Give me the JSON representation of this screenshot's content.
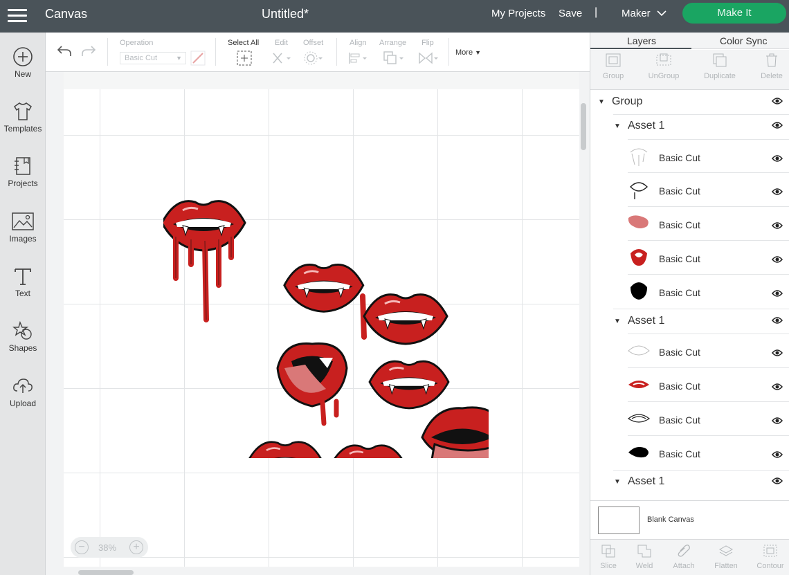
{
  "header": {
    "app_title": "Canvas",
    "doc_title": "Untitled*",
    "my_projects": "My Projects",
    "save": "Save",
    "separator": "|",
    "machine": "Maker",
    "make_it": "Make It",
    "make_color": "#1aa562"
  },
  "sidebar": {
    "items": [
      {
        "label": "New",
        "icon": "plus-circle-icon"
      },
      {
        "label": "Templates",
        "icon": "tshirt-icon"
      },
      {
        "label": "Projects",
        "icon": "projects-icon"
      },
      {
        "label": "Images",
        "icon": "image-icon"
      },
      {
        "label": "Text",
        "icon": "text-icon"
      },
      {
        "label": "Shapes",
        "icon": "shapes-icon"
      },
      {
        "label": "Upload",
        "icon": "upload-icon"
      }
    ]
  },
  "toolbar": {
    "operation_label": "Operation",
    "operation_value": "Basic Cut",
    "select_all": "Select All",
    "edit": "Edit",
    "offset": "Offset",
    "align": "Align",
    "arrange": "Arrange",
    "flip": "Flip",
    "more": "More"
  },
  "canvas": {
    "zoom": "38%",
    "zoom_minus": "−",
    "zoom_plus": "+",
    "artwork": "vampire lips designs",
    "accent_red": "#c8201f"
  },
  "panel": {
    "tabs": [
      "Layers",
      "Color Sync"
    ],
    "tools": [
      "Group",
      "UnGroup",
      "Duplicate",
      "Delete"
    ],
    "group_name": "Group",
    "assets": [
      {
        "name": "Asset 1",
        "layers": [
          "Basic Cut",
          "Basic Cut",
          "Basic Cut",
          "Basic Cut",
          "Basic Cut"
        ]
      },
      {
        "name": "Asset 1",
        "layers": [
          "Basic Cut",
          "Basic Cut",
          "Basic Cut",
          "Basic Cut"
        ]
      },
      {
        "name": "Asset 1",
        "layers": []
      }
    ],
    "blank_canvas": "Blank Canvas",
    "bottom_tools": [
      "Slice",
      "Weld",
      "Attach",
      "Flatten",
      "Contour"
    ]
  }
}
